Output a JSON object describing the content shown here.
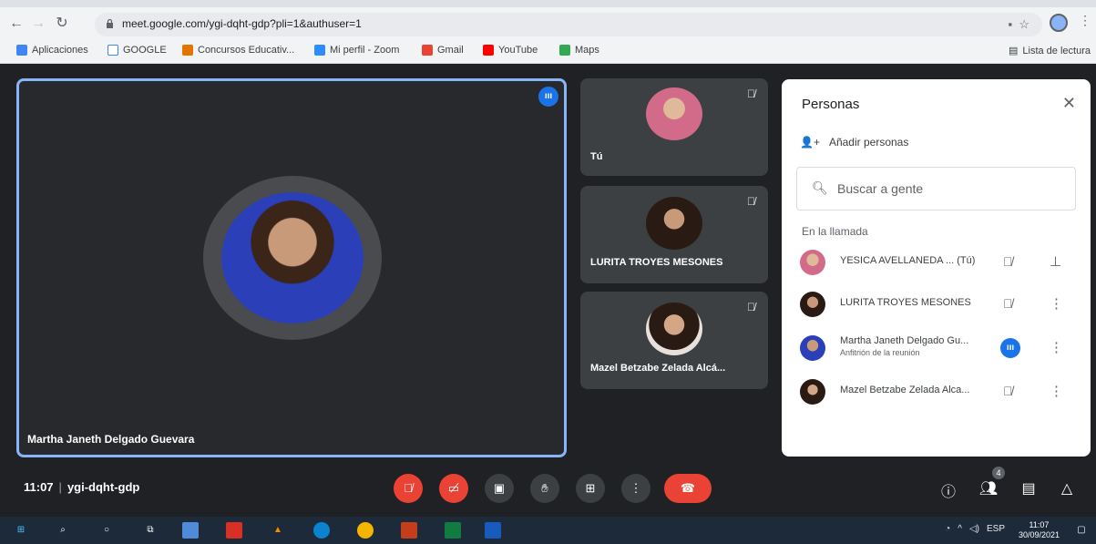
{
  "browser": {
    "url": "meet.google.com/ygi-dqht-gdp?pli=1&authuser=1",
    "bookmarks": [
      {
        "label": "Aplicaciones",
        "color": "#4285f4"
      },
      {
        "label": "GOOGLE",
        "color": "#4285f4"
      },
      {
        "label": "Concursos Educativ...",
        "color": "#e37400"
      },
      {
        "label": "Mi perfil - Zoom",
        "color": "#2d8cff"
      },
      {
        "label": "Gmail",
        "color": "#ea4335"
      },
      {
        "label": "YouTube",
        "color": "#ff0000"
      },
      {
        "label": "Maps",
        "color": "#34a853"
      }
    ],
    "reading_list": "Lista de lectura"
  },
  "main_tile": {
    "name": "Martha Janeth Delgado Guevara"
  },
  "side_tiles": [
    {
      "name": "Tú"
    },
    {
      "name": "LURITA TROYES MESONES"
    },
    {
      "name": "Mazel Betzabe Zelada Alcá..."
    }
  ],
  "panel": {
    "title": "Personas",
    "add_people": "Añadir personas",
    "search_placeholder": "Buscar a gente",
    "in_call_label": "En la llamada",
    "people": [
      {
        "name": "YESICA AVELLANEDA ...  (Tú)",
        "sub": ""
      },
      {
        "name": "LURITA TROYES MESONES",
        "sub": ""
      },
      {
        "name": "Martha Janeth Delgado Gu...",
        "sub": "Anfitrión de la reunión"
      },
      {
        "name": "Mazel Betzabe Zelada Alca...",
        "sub": ""
      }
    ]
  },
  "controls": {
    "time": "11:07",
    "meeting_code": "ygi-dqht-gdp",
    "participants_count": "4"
  },
  "taskbar": {
    "language": "ESP",
    "time": "11:07",
    "date": "30/09/2021"
  },
  "colors": {
    "accent_blue": "#1a73e8",
    "danger_red": "#ea4335",
    "tile_bg": "#3c4043",
    "meet_bg": "#202124"
  }
}
